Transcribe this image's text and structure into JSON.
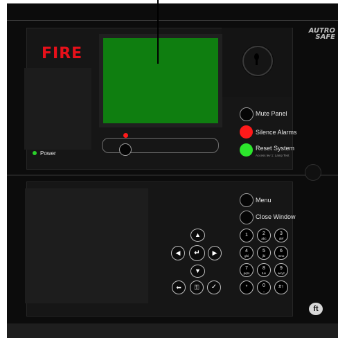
{
  "panel": {
    "fire_label": "FIRE",
    "logo_line1": "AUTRO",
    "logo_line2": "SAFE",
    "power_label": "Power"
  },
  "buttons": {
    "mute_panel": "Mute Panel",
    "silence_alarms": "Silence Alarms",
    "reset_system": "Reset System",
    "reset_hint": "Access lev 1: Lamp Test",
    "menu": "Menu",
    "close_window": "Close Window"
  },
  "keypad": [
    {
      "num": "1",
      "sub": ""
    },
    {
      "num": "2",
      "sub": "abc"
    },
    {
      "num": "3",
      "sub": "def"
    },
    {
      "num": "4",
      "sub": "ghi"
    },
    {
      "num": "5",
      "sub": "jkl"
    },
    {
      "num": "6",
      "sub": "mno"
    },
    {
      "num": "7",
      "sub": "pqrs"
    },
    {
      "num": "8",
      "sub": "tuv"
    },
    {
      "num": "9",
      "sub": "wxyz"
    },
    {
      "num": "*",
      "sub": ""
    },
    {
      "num": "0",
      "sub": "⎵"
    },
    {
      "num": "#↑",
      "sub": ""
    }
  ],
  "icons": {
    "nav_up": "▲",
    "nav_down": "▼",
    "nav_left": "◀",
    "nav_right": "▶",
    "nav_enter": "↵",
    "back": "⬅",
    "key": "⚿",
    "check": "✓",
    "brand": "ft"
  },
  "colors": {
    "fire": "#e8101a",
    "lcd": "#0f7e10",
    "silence": "#ff1a1a",
    "reset": "#2ce62c",
    "power_led": "#2ad12a",
    "alarm_led": "#ff1a1a"
  }
}
